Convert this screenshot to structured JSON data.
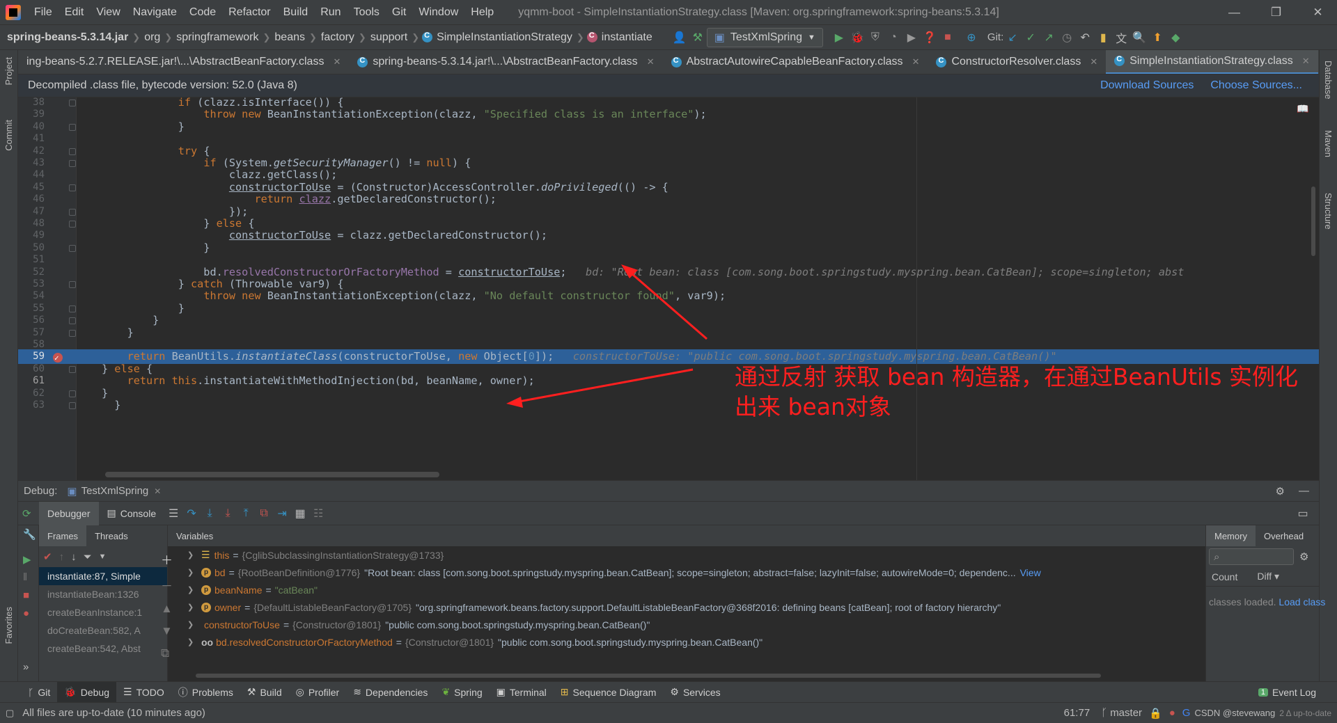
{
  "menu": [
    "File",
    "Edit",
    "View",
    "Navigate",
    "Code",
    "Refactor",
    "Build",
    "Run",
    "Tools",
    "Git",
    "Window",
    "Help"
  ],
  "window_title": "yqmm-boot - SimpleInstantiationStrategy.class [Maven: org.springframework:spring-beans:5.3.14]",
  "breadcrumb": [
    "spring-beans-5.3.14.jar",
    "org",
    "springframework",
    "beans",
    "factory",
    "support",
    "SimpleInstantiationStrategy",
    "instantiate"
  ],
  "run_config": "TestXmlSpring",
  "git_label": "Git:",
  "tabs": [
    {
      "label": "ing-beans-5.2.7.RELEASE.jar!\\...\\AbstractBeanFactory.class",
      "active": false
    },
    {
      "label": "spring-beans-5.3.14.jar!\\...\\AbstractBeanFactory.class",
      "active": false
    },
    {
      "label": "AbstractAutowireCapableBeanFactory.class",
      "active": false
    },
    {
      "label": "ConstructorResolver.class",
      "active": false
    },
    {
      "label": "SimpleInstantiationStrategy.class",
      "active": true
    }
  ],
  "banner": {
    "text": "Decompiled .class file, bytecode version: 52.0 (Java 8)",
    "download": "Download Sources",
    "choose": "Choose Sources..."
  },
  "side_left": [
    "Project",
    "Commit",
    "Favorites"
  ],
  "side_right": [
    "Database",
    "Maven",
    "Structure"
  ],
  "code_lines": [
    {
      "n": "38",
      "html": "            <span class='kw'>if</span> (clazz.isInterface()) {"
    },
    {
      "n": "39",
      "html": "                <span class='kw'>throw new</span> BeanInstantiationException(clazz, <span class='st'>\"Specified class is an interface\"</span>);"
    },
    {
      "n": "40",
      "html": "            }"
    },
    {
      "n": "41",
      "html": ""
    },
    {
      "n": "42",
      "html": "            <span class='kw'>try</span> {"
    },
    {
      "n": "43",
      "html": "                <span class='kw'>if</span> (System.<span class='it'>getSecurityManager</span>() != <span class='kw'>null</span>) {"
    },
    {
      "n": "44",
      "html": "                    clazz.getClass();"
    },
    {
      "n": "45",
      "html": "                    <span class='ul'>constructorToUse</span> = (Constructor)AccessController.<span class='it'>doPrivileged</span>(() -> {"
    },
    {
      "n": "46",
      "html": "                        <span class='kw'>return</span> <span class='fld ul'>clazz</span>.getDeclaredConstructor();"
    },
    {
      "n": "47",
      "html": "                    });"
    },
    {
      "n": "48",
      "html": "                } <span class='kw'>else</span> {"
    },
    {
      "n": "49",
      "html": "                    <span class='ul'>constructorToUse</span> = clazz.getDeclaredConstructor();"
    },
    {
      "n": "50",
      "html": "                }"
    },
    {
      "n": "51",
      "html": ""
    },
    {
      "n": "52",
      "html": "                bd.<span class='fld'>resolvedConstructorOrFactoryMethod</span> = <span class='ul'>constructorToUse</span>;   <span class='hint'>bd: \"Root bean: class [com.song.boot.springstudy.myspring.bean.CatBean]; scope=singleton; abst</span>"
    },
    {
      "n": "53",
      "html": "            } <span class='kw'>catch</span> (Throwable var9) {"
    },
    {
      "n": "54",
      "html": "                <span class='kw'>throw new</span> BeanInstantiationException(clazz, <span class='st'>\"No default constructor found\"</span>, var9);"
    },
    {
      "n": "55",
      "html": "            }"
    },
    {
      "n": "56",
      "html": "        }"
    },
    {
      "n": "57",
      "html": "    }"
    },
    {
      "n": "58",
      "html": ""
    },
    {
      "n": "59",
      "html": "    <span class='kw'>return</span> BeanUtils.<span class='it'>instantiateClass</span>(constructorToUse, <span class='kw'>new</span> Object[<span class='num'>0</span>]);   <span class='hint'>constructorToUse: \"public com.song.boot.springstudy.myspring.bean.CatBean()\"</span>"
    },
    {
      "n": "60",
      "html": "} <span class='kw'>else</span> {"
    },
    {
      "n": "61",
      "html": "    <span class='kw'>return this</span>.instantiateWithMethodInjection(bd, beanName, owner);"
    },
    {
      "n": "62",
      "html": "}"
    },
    {
      "n": "63",
      "html": "  }"
    }
  ],
  "annotation": "通过反射  获取 bean 构造器，在通过BeanUtils 实例化出来 bean对象",
  "debug": {
    "label": "Debug:",
    "config": "TestXmlSpring",
    "tabs": [
      "Debugger",
      "Console"
    ],
    "subtabs": [
      "Frames",
      "Threads"
    ],
    "variables_label": "Variables",
    "memory_tabs": [
      "Memory",
      "Overhead"
    ],
    "count": "Count",
    "diff": "Diff",
    "classes_loaded": "classes loaded.",
    "load_classes": "Load class",
    "frames": [
      "instantiate:87, Simple",
      "instantiateBean:1326",
      "createBeanInstance:1",
      "doCreateBean:582, A",
      "createBean:542, Abst"
    ],
    "variables": [
      {
        "name": "this",
        "type": "{CglibSubclassingInstantiationStrategy@1733}",
        "value": "",
        "badge": "list"
      },
      {
        "name": "bd",
        "type": "{RootBeanDefinition@1776}",
        "value": "\"Root bean: class [com.song.boot.springstudy.myspring.bean.CatBean]; scope=singleton; abstract=false; lazyInit=false; autowireMode=0; dependenc...",
        "badge": "p",
        "view": "View"
      },
      {
        "name": "beanName",
        "type": "",
        "value": "\"catBean\"",
        "badge": "p"
      },
      {
        "name": "owner",
        "type": "{DefaultListableBeanFactory@1705}",
        "value": "\"org.springframework.beans.factory.support.DefaultListableBeanFactory@368f2016: defining beans [catBean]; root of factory hierarchy\"",
        "badge": "p"
      },
      {
        "name": "constructorToUse",
        "type": "{Constructor@1801}",
        "value": "\"public com.song.boot.springstudy.myspring.bean.CatBean()\"",
        "badge": "none"
      },
      {
        "name": "bd.resolvedConstructorOrFactoryMethod",
        "type": "{Constructor@1801}",
        "value": "\"public com.song.boot.springstudy.myspring.bean.CatBean()\"",
        "badge": "oo"
      }
    ]
  },
  "bottom_tabs": [
    "Git",
    "Debug",
    "TODO",
    "Problems",
    "Build",
    "Profiler",
    "Dependencies",
    "Spring",
    "Terminal",
    "Sequence Diagram",
    "Services"
  ],
  "event_log": "Event Log",
  "event_count": "1",
  "status": {
    "message": "All files are up-to-date (10 minutes ago)",
    "position": "61:77",
    "branch": "master",
    "right": "CSDN @stevewang",
    "upd": "2 Δ up-to-date"
  },
  "colors": {
    "accent": "#4a88c7",
    "highlight": "#2d6099",
    "annotation": "#ff1f1f"
  }
}
